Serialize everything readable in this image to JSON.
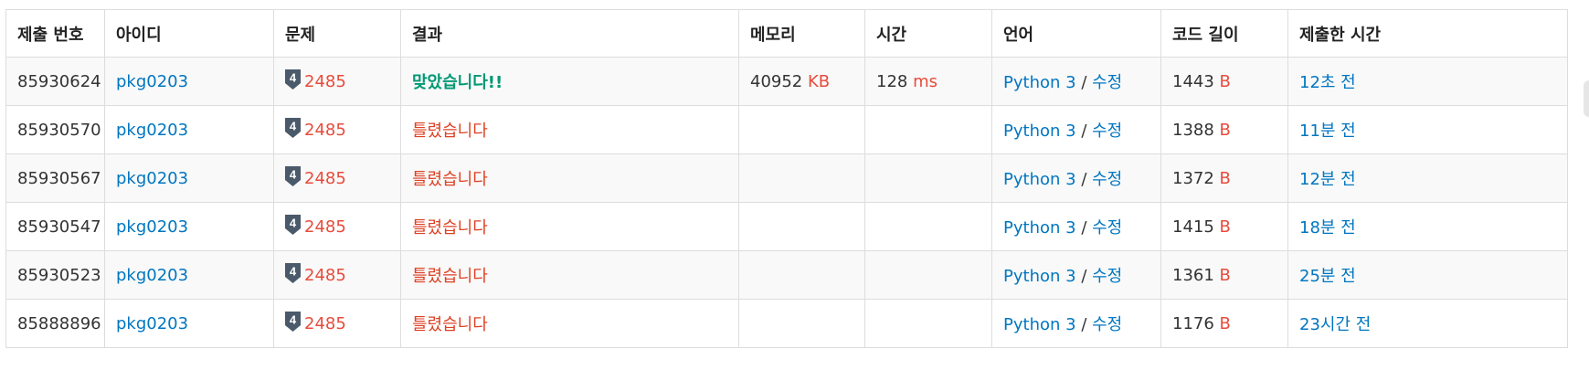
{
  "table": {
    "headers": [
      "제출 번호",
      "아이디",
      "문제",
      "결과",
      "메모리",
      "시간",
      "언어",
      "코드 길이",
      "제출한 시간"
    ],
    "rows": [
      {
        "submission_id": "85930624",
        "user": "pkg0203",
        "tier": "4",
        "problem": "2485",
        "result": "맞았습니다!!",
        "result_type": "accepted",
        "memory": "40952",
        "memory_unit": "KB",
        "time": "128",
        "time_unit": "ms",
        "language": "Python 3",
        "separator": "/",
        "edit": "수정",
        "code_length": "1443",
        "code_unit": "B",
        "submitted_at": "12초 전"
      },
      {
        "submission_id": "85930570",
        "user": "pkg0203",
        "tier": "4",
        "problem": "2485",
        "result": "틀렸습니다",
        "result_type": "wrong",
        "memory": "",
        "memory_unit": "",
        "time": "",
        "time_unit": "",
        "language": "Python 3",
        "separator": "/",
        "edit": "수정",
        "code_length": "1388",
        "code_unit": "B",
        "submitted_at": "11분 전"
      },
      {
        "submission_id": "85930567",
        "user": "pkg0203",
        "tier": "4",
        "problem": "2485",
        "result": "틀렸습니다",
        "result_type": "wrong",
        "memory": "",
        "memory_unit": "",
        "time": "",
        "time_unit": "",
        "language": "Python 3",
        "separator": "/",
        "edit": "수정",
        "code_length": "1372",
        "code_unit": "B",
        "submitted_at": "12분 전"
      },
      {
        "submission_id": "85930547",
        "user": "pkg0203",
        "tier": "4",
        "problem": "2485",
        "result": "틀렸습니다",
        "result_type": "wrong",
        "memory": "",
        "memory_unit": "",
        "time": "",
        "time_unit": "",
        "language": "Python 3",
        "separator": "/",
        "edit": "수정",
        "code_length": "1415",
        "code_unit": "B",
        "submitted_at": "18분 전"
      },
      {
        "submission_id": "85930523",
        "user": "pkg0203",
        "tier": "4",
        "problem": "2485",
        "result": "틀렸습니다",
        "result_type": "wrong",
        "memory": "",
        "memory_unit": "",
        "time": "",
        "time_unit": "",
        "language": "Python 3",
        "separator": "/",
        "edit": "수정",
        "code_length": "1361",
        "code_unit": "B",
        "submitted_at": "25분 전"
      },
      {
        "submission_id": "85888896",
        "user": "pkg0203",
        "tier": "4",
        "problem": "2485",
        "result": "틀렸습니다",
        "result_type": "wrong",
        "memory": "",
        "memory_unit": "",
        "time": "",
        "time_unit": "",
        "language": "Python 3",
        "separator": "/",
        "edit": "수정",
        "code_length": "1176",
        "code_unit": "B",
        "submitted_at": "23시간 전"
      }
    ]
  },
  "icons": {
    "tier_badge": "tier-badge-icon"
  },
  "colors": {
    "link": "#0076c0",
    "unit": "#e74c3c",
    "accepted": "#009874",
    "wrong": "#dd4124",
    "tier_badge": "#4a5a6a"
  }
}
